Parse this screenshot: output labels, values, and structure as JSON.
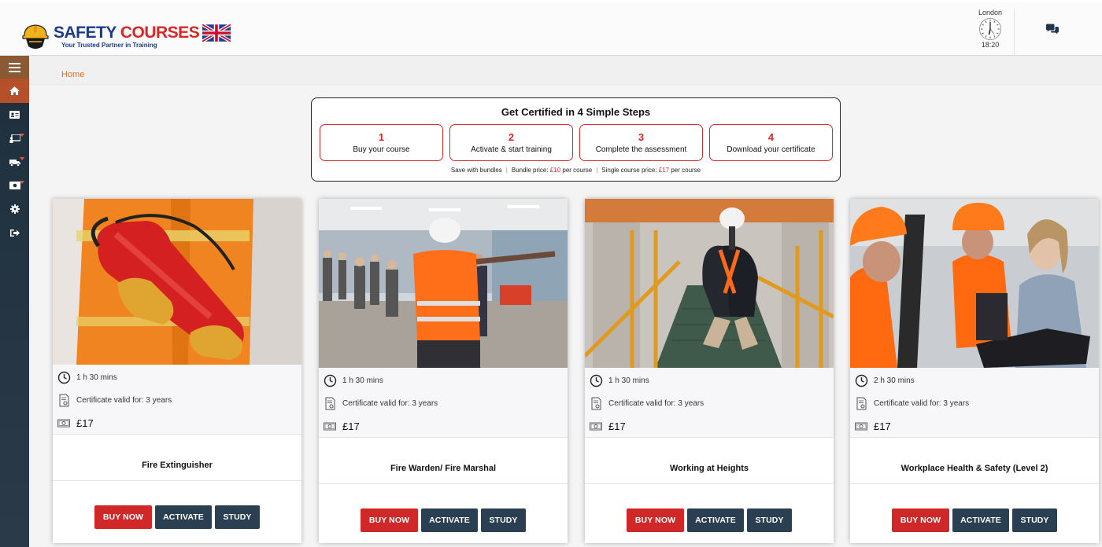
{
  "header": {
    "brand_left": "SAFETY",
    "brand_right": "COURSES",
    "tagline": "Your Trusted Partner in Training",
    "clock_city": "London",
    "clock_time": "18:20"
  },
  "breadcrumb": "Home",
  "steps": {
    "title": "Get Certified in 4 Simple Steps",
    "items": [
      {
        "num": "1",
        "label": "Buy your course"
      },
      {
        "num": "2",
        "label": "Activate & start training"
      },
      {
        "num": "3",
        "label": "Complete the assessment"
      },
      {
        "num": "4",
        "label": "Download your certificate"
      }
    ],
    "footer": {
      "bundles": "Save with bundles",
      "bundle_prefix": "Bundle price: ",
      "bundle_price": "£10",
      "bundle_suffix": " per course",
      "single_prefix": "Single course price: ",
      "single_price": "£17",
      "single_suffix": " per course"
    }
  },
  "courses": [
    {
      "title": "Fire Extinguisher",
      "duration": "1 h 30 mins",
      "validity": "Certificate valid for: 3 years",
      "price": "£17"
    },
    {
      "title": "Fire Warden/ Fire Marshal",
      "duration": "1 h 30 mins",
      "validity": "Certificate valid for: 3 years",
      "price": "£17"
    },
    {
      "title": "Working at Heights",
      "duration": "1 h 30 mins",
      "validity": "Certificate valid for: 3 years",
      "price": "£17"
    },
    {
      "title": "Workplace Health & Safety (Level 2)",
      "duration": "2 h 30 mins",
      "validity": "Certificate valid for: 3 years",
      "price": "£17"
    }
  ],
  "buttons": {
    "buy": "BUY NOW",
    "activate": "ACTIVATE",
    "study": "STUDY"
  },
  "colors": {
    "accent_red": "#d02828",
    "navy": "#2a3f52",
    "sidebar": "#1e2f3d",
    "breadcrumb": "#e0702a"
  },
  "icons": {
    "menu": "hamburger-icon",
    "chat": "chat-bubbles-icon",
    "duration": "clock-icon",
    "certificate": "certificate-icon",
    "price": "cash-icon"
  }
}
